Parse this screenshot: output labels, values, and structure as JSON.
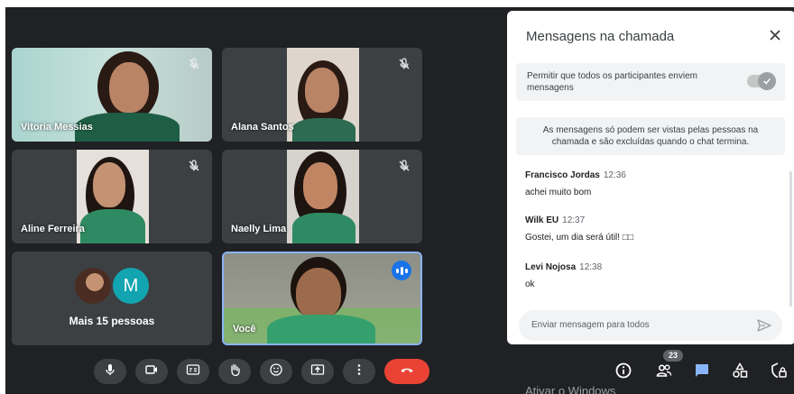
{
  "participants": [
    {
      "name": "Vitoria Messias",
      "muted": true
    },
    {
      "name": "Alana Santos",
      "muted": true
    },
    {
      "name": "Aline Ferreira",
      "muted": true
    },
    {
      "name": "Naelly Lima",
      "muted": true
    }
  ],
  "more_tile": {
    "avatar_letter": "M",
    "label": "Mais 15 pessoas"
  },
  "self_tile": {
    "name": "Você"
  },
  "chat": {
    "title": "Mensagens na chamada",
    "permission_text": "Permitir que todos os participantes enviem mensagens",
    "permission_enabled": true,
    "info_text": "As mensagens só podem ser vistas pelas pessoas na chamada e são excluídas quando o chat termina.",
    "messages": [
      {
        "sender": "Francisco Jordas",
        "time": "12:36",
        "text": "achei muito bom"
      },
      {
        "sender": "Wilk EU",
        "time": "12:37",
        "text": "Gostei, um dia será útil! □□"
      },
      {
        "sender": "Levi Nojosa",
        "time": "12:38",
        "text": "ok"
      }
    ],
    "input_placeholder": "Enviar mensagem para todos"
  },
  "controls": [
    "mic-icon",
    "camera-icon",
    "captions-icon",
    "raise-hand-icon",
    "emoji-icon",
    "present-icon",
    "more-options-icon",
    "hang-up-icon"
  ],
  "right_controls": {
    "people_count": "23",
    "icons": [
      "info-icon",
      "people-icon",
      "chat-icon",
      "activities-icon",
      "host-controls-icon"
    ]
  },
  "colors": {
    "accent_blue": "#1a73e8",
    "hangup_red": "#ea4335",
    "chat_active": "#8ab4f8",
    "stage_bg": "#202124",
    "tile_bg": "#3c4043"
  },
  "watermark": "Ativar o Windows"
}
